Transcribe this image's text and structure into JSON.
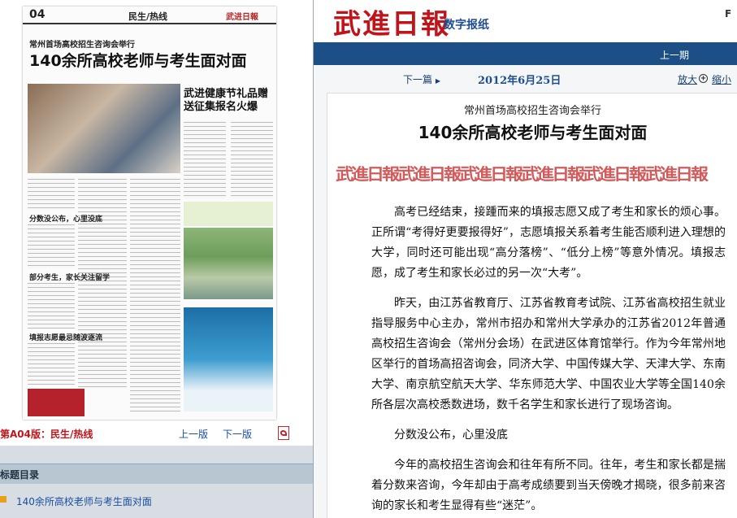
{
  "left_panel": {
    "thumbnail": {
      "page_number": "04",
      "section": "民生/热线",
      "logo": "武进日報",
      "kicker": "常州首场高校招生咨询会举行",
      "title": "140余所高校老师与考生面对面",
      "side_title": "武进健康节礼品赠送征集报名火爆",
      "subheads": [
        "分数没公布，心里没底",
        "部分考生，家长关注留学",
        "填报志愿最忌随波逐流"
      ]
    },
    "nav": {
      "current_page": "第A04版：民生/热线",
      "prev_page": "上一版",
      "next_page": "下一版",
      "pdf_icon": "pdf-icon"
    },
    "topics": {
      "heading": "标题目录",
      "items": [
        "140余所高校老师与考生面对面"
      ]
    }
  },
  "right_panel": {
    "masthead": {
      "logo": "武進日報",
      "edition": "数字报纸",
      "corner": "F"
    },
    "bluebar": {
      "prev_issue": "上一期"
    },
    "toolbar": {
      "next_article": "下一篇",
      "date": "2012年6月25日",
      "zoom_in": "放大",
      "zoom_out": "缩小"
    },
    "article": {
      "kicker": "常州首场高校招生咨询会举行",
      "title": "140余所高校老师与考生面对面",
      "stamp": "武進日報武進日報武進日報武進日報武進日報武進日報",
      "paragraphs": [
        "高考已经结束，接踵而来的填报志愿又成了考生和家长的烦心事。正所谓“考得好更要报得好”，志愿填报关系着考生能否顺利进入理想的大学，同时还可能出现“高分落榜”、“低分上榜”等意外情况。填报志愿，成了考生和家长必过的另一次“大考”。",
        "昨天，由江苏省教育厅、江苏省教育考试院、江苏省高校招生就业指导服务中心主办，常州市招办和常州大学承办的江苏省2012年普通高校招生咨询会（常州分会场）在武进区体育馆举行。作为今年常州地区举行的首场高招咨询会，同济大学、中国传媒大学、天津大学、东南大学、南京航空航天大学、华东师范大学、中国农业大学等全国140余所各层次高校悉数进场，数千名学生和家长进行了现场咨询。",
        "分数没公布，心里没底",
        "今年的高校招生咨询会和往年有所不同。往年，考生和家长都是揣着分数来咨询，今年却由于高考成绩要到当天傍晚才揭晓，很多前来咨询的家长和考生显得有些“迷茫”。"
      ]
    }
  },
  "colors": {
    "brand_red": "#c0141b",
    "nav_blue": "#1b4f86",
    "link_blue": "#1a4fa0"
  }
}
